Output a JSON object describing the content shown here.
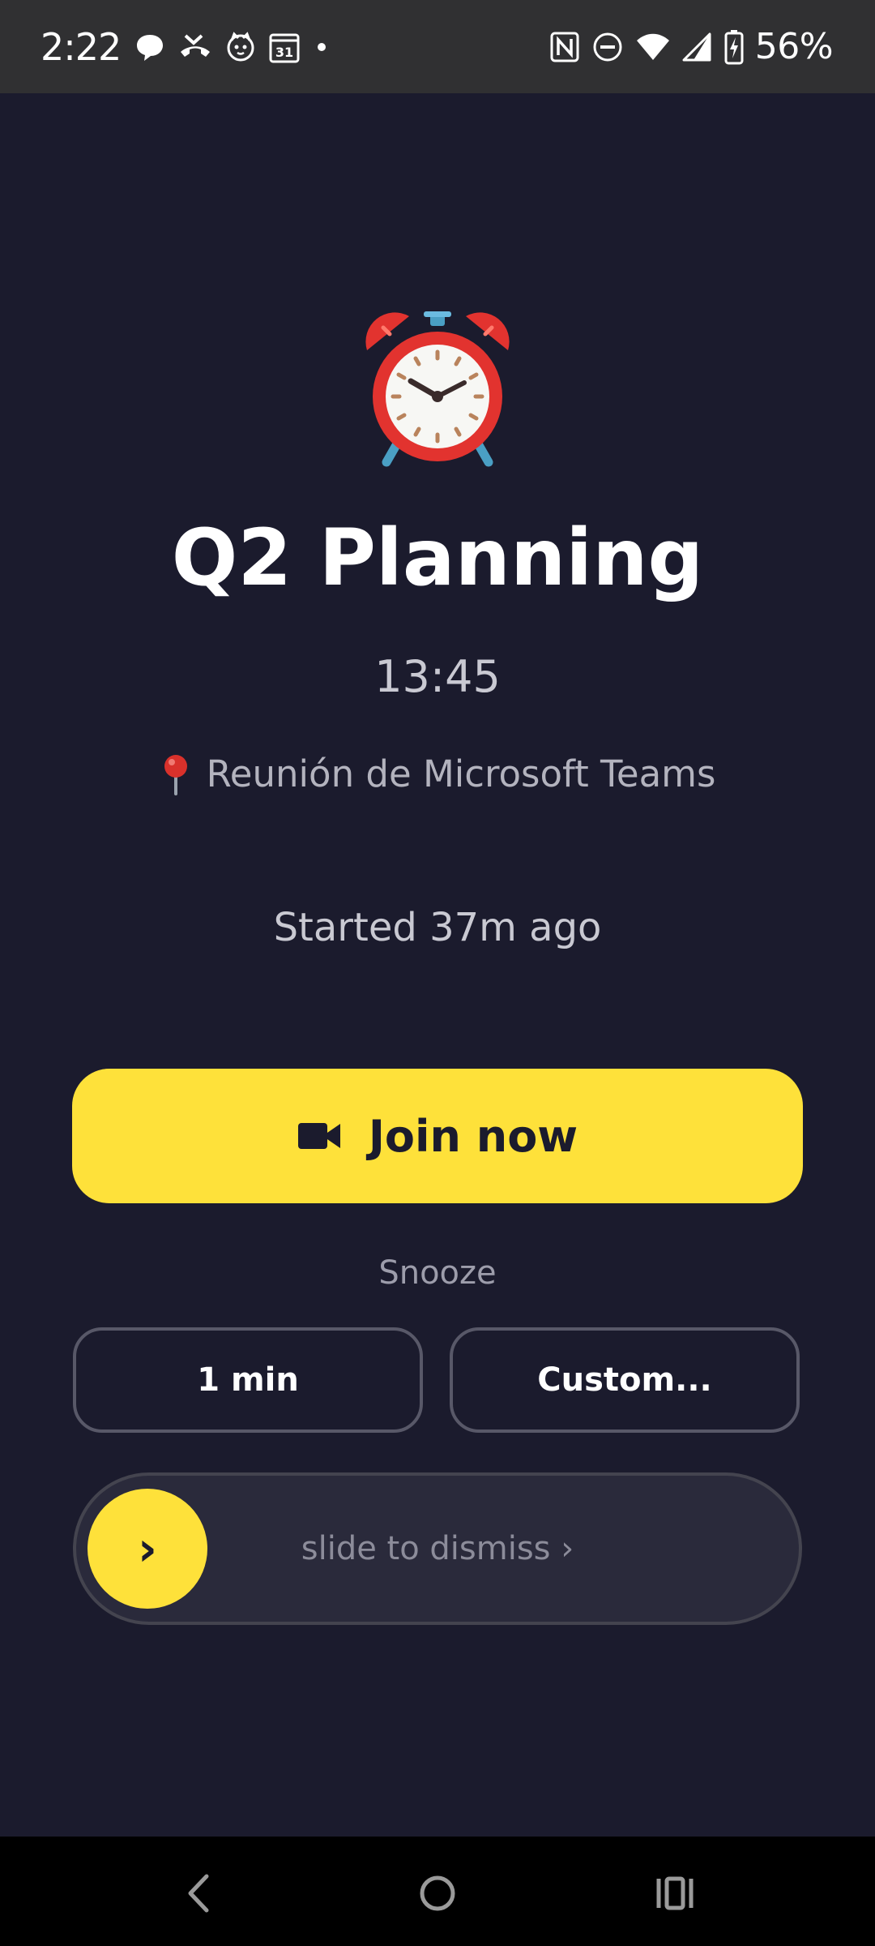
{
  "status_bar": {
    "time": "2:22",
    "battery": "56%",
    "calendar_day": "31",
    "left_icons": [
      "chat-bubble-icon",
      "missed-call-icon",
      "cat-app-icon",
      "calendar-icon",
      "dot-icon"
    ],
    "right_icons": [
      "nfc-icon",
      "do-not-disturb-icon",
      "wifi-icon",
      "signal-icon",
      "battery-charging-icon"
    ]
  },
  "alarm": {
    "icon": "alarm-clock-icon",
    "title": "Q2 Planning",
    "time": "13:45",
    "location_icon": "pin-icon",
    "location": "Reunión de Microsoft Teams",
    "started": "Started 37m ago"
  },
  "actions": {
    "join_icon": "video-camera-icon",
    "join_label": "Join now",
    "snooze_label": "Snooze",
    "snooze_options": [
      "1 min",
      "Custom..."
    ],
    "dismiss_handle": "›",
    "dismiss_text": "slide to dismiss ›"
  },
  "nav_bar": {
    "icons": [
      "back-icon",
      "home-icon",
      "recents-icon"
    ]
  },
  "colors": {
    "background": "#1b1b2d",
    "accent": "#fee13a",
    "status_bar": "#303032"
  }
}
